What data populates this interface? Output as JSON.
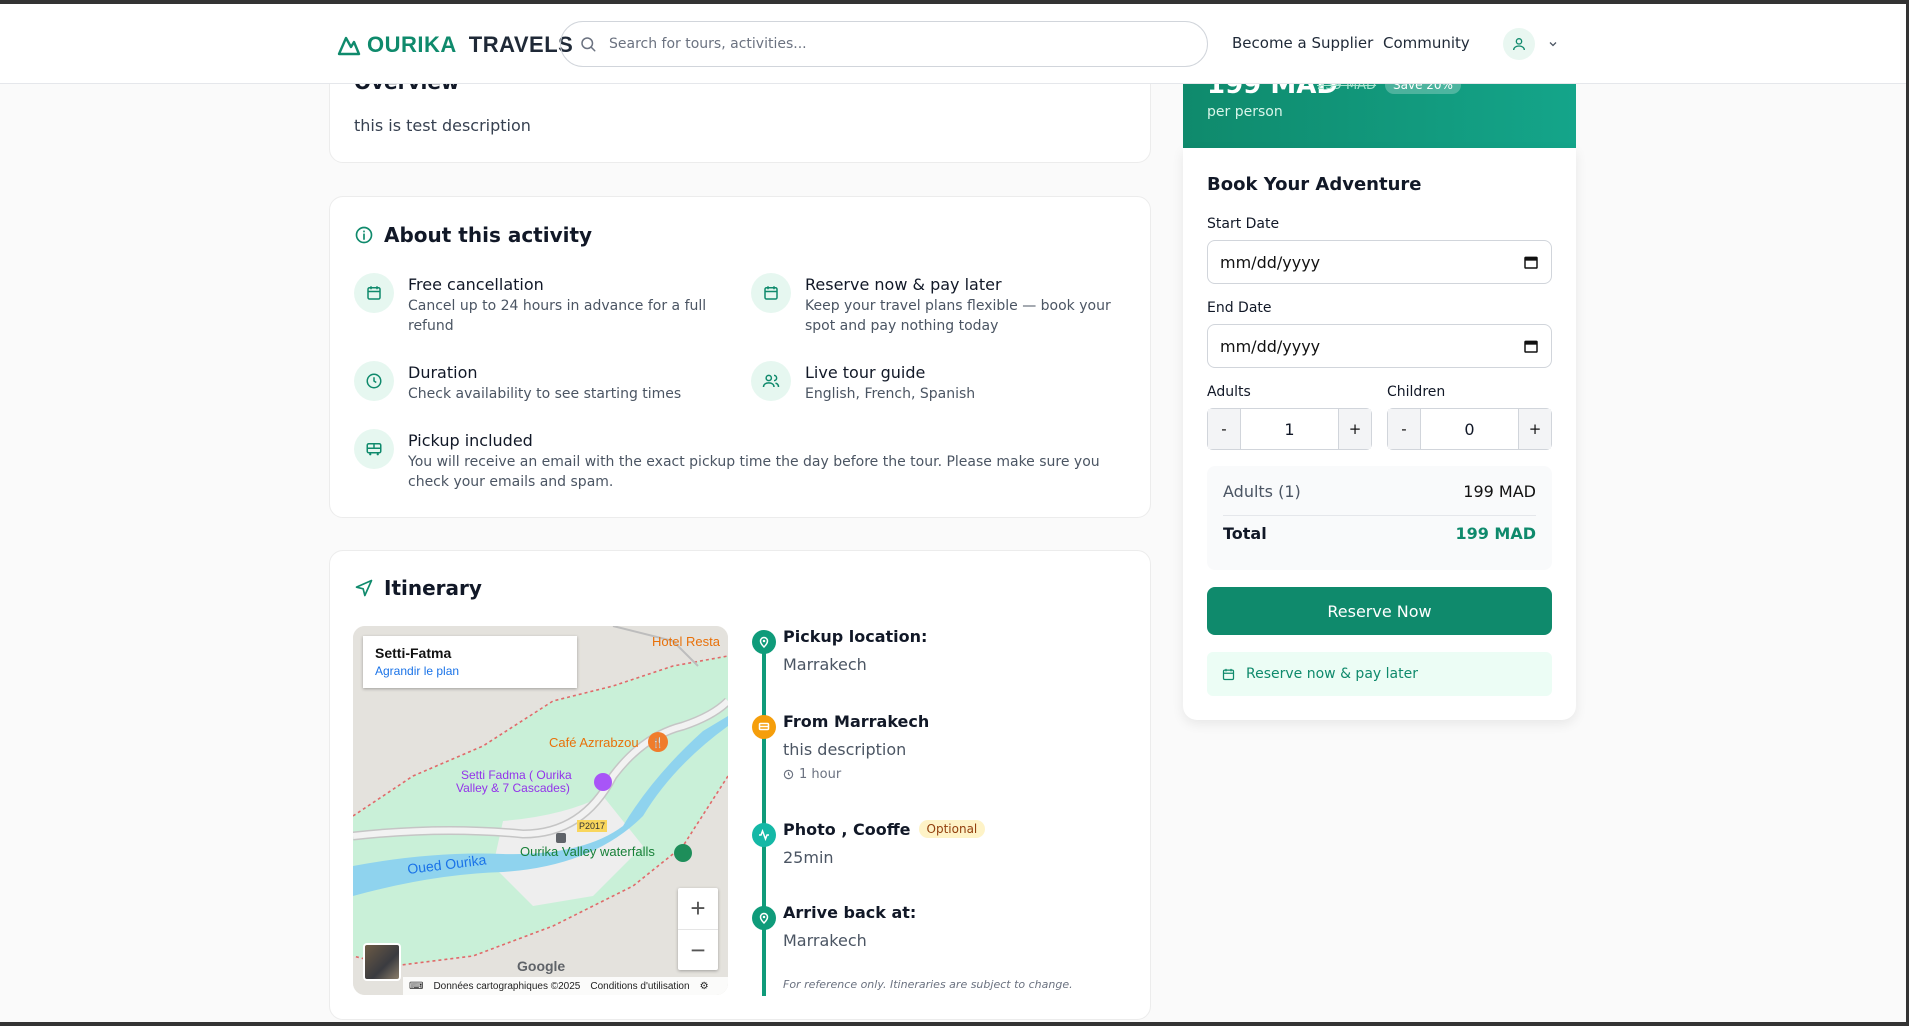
{
  "header": {
    "logo_part1": "OURIKA",
    "logo_part2": "TRAVELS",
    "search_placeholder": "Search for tours, activities...",
    "nav": [
      "Become a Supplier",
      "Community"
    ]
  },
  "overview": {
    "title": "Overview",
    "description": "this is test description"
  },
  "about": {
    "title": "About this activity",
    "features": [
      {
        "icon": "calendar-icon",
        "title": "Free cancellation",
        "desc": "Cancel up to 24 hours in advance for a full refund"
      },
      {
        "icon": "calendar-icon",
        "title": "Reserve now & pay later",
        "desc": "Keep your travel plans flexible — book your spot and pay nothing today"
      },
      {
        "icon": "clock-icon",
        "title": "Duration",
        "desc": "Check availability to see starting times"
      },
      {
        "icon": "users-icon",
        "title": "Live tour guide",
        "desc": "English, French, Spanish"
      },
      {
        "icon": "bus-icon",
        "title": "Pickup included",
        "desc": "You will receive an email with the exact pickup time the day before the tour. Please make sure you check your emails and spam."
      }
    ]
  },
  "itinerary": {
    "title": "Itinerary",
    "map": {
      "place_title": "Setti-Fatma",
      "enlarge_link": "Agrandir le plan",
      "labels": [
        "Hotel Resta",
        "Café Azrrabzou",
        "Setti Fadma ( Ourika Valley & 7 Cascades)",
        "P2017",
        "Oued Ourika",
        "Ourika Valley waterfalls"
      ],
      "footer": [
        "Données cartographiques ©2025",
        "Conditions d'utilisation"
      ],
      "google": "Google"
    },
    "steps": [
      {
        "title": "Pickup location:",
        "desc": "Marrakech",
        "color": "#0f9b7a",
        "icon": "map-pin-icon"
      },
      {
        "title": "From Marrakech",
        "desc": "this description",
        "time": "1 hour",
        "color": "#f59e0b",
        "icon": "bus-icon"
      },
      {
        "title": "Photo , Cooffe",
        "badge": "Optional",
        "desc": "25min",
        "color": "#14b8a6",
        "icon": "activity-icon"
      },
      {
        "title": "Arrive back at:",
        "desc": "Marrakech",
        "color": "#0f9b7a",
        "icon": "map-pin-icon"
      }
    ],
    "note": "For reference only. Itineraries are subject to change."
  },
  "booking": {
    "price": "199 MAD",
    "old_price": "239 MAD",
    "save": "Save 20%",
    "per": "per person",
    "title": "Book Your Adventure",
    "start_label": "Start Date",
    "end_label": "End Date",
    "date_placeholder": "mm/dd/yyyy",
    "adults_label": "Adults",
    "children_label": "Children",
    "adults_value": "1",
    "children_value": "0",
    "minus": "-",
    "plus": "+",
    "line_label": "Adults (1)",
    "line_value": "199 MAD",
    "total_label": "Total",
    "total_value": "199 MAD",
    "reserve_button": "Reserve Now",
    "pay_later": "Reserve now & pay later"
  },
  "colors": {
    "accent": "#0f8a6c"
  }
}
